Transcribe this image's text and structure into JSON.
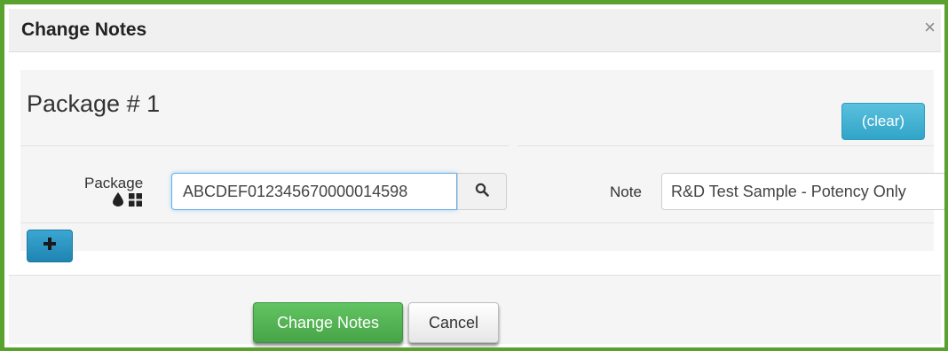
{
  "dialog": {
    "title": "Change Notes",
    "close_icon": "close-icon",
    "close_glyph": "×"
  },
  "package": {
    "heading": "Package # 1",
    "clear_label": "(clear)",
    "package_label": "Package",
    "package_value": "ABCDEF012345670000014598",
    "label_icons": [
      "droplet-icon",
      "grid-icon"
    ],
    "search_icon": "search-icon",
    "note_label": "Note",
    "note_value": "R&D Test Sample - Potency Only",
    "add_icon": "plus-icon"
  },
  "footer": {
    "submit_label": "Change Notes",
    "cancel_label": "Cancel"
  },
  "colors": {
    "frame_border": "#5aa12f",
    "info_button": "#5bc0de",
    "primary_button": "#5cb85c",
    "add_button": "#2a8fbd"
  }
}
